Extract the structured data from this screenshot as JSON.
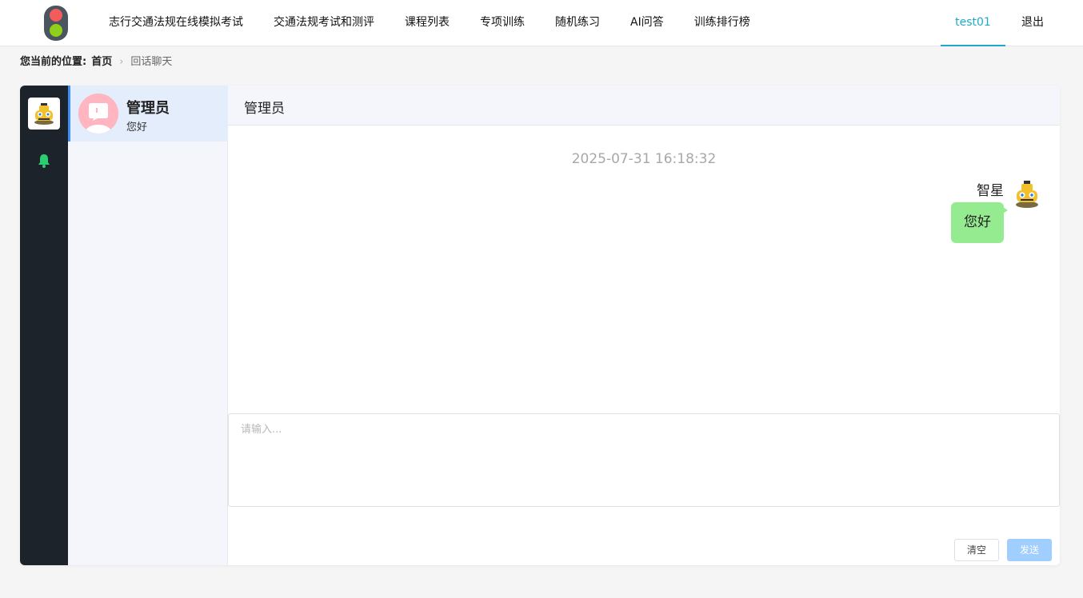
{
  "nav": {
    "items": [
      {
        "label": "志行交通法规在线模拟考试"
      },
      {
        "label": "交通法规考试和测评"
      },
      {
        "label": "课程列表"
      },
      {
        "label": "专项训练"
      },
      {
        "label": "随机练习"
      },
      {
        "label": "AI问答"
      },
      {
        "label": "训练排行榜"
      }
    ],
    "user": "test01",
    "logout": "退出"
  },
  "breadcrumb": {
    "label": "您当前的位置:",
    "home": "首页",
    "separator": "›",
    "current": "回话聊天"
  },
  "contacts": [
    {
      "name": "管理员",
      "last_message": "您好",
      "active": true
    }
  ],
  "chat": {
    "title": "管理员",
    "messages": [
      {
        "time": "2025-07-31 16:18:32",
        "sender": "智星",
        "text": "您好",
        "own": true
      }
    ],
    "input_placeholder": "请输入...",
    "clear_label": "清空",
    "send_label": "发送"
  },
  "colors": {
    "accent": "#21a9c9",
    "rail": "#1c232b",
    "bubble": "#95ec90",
    "send_button": "#a0cfff",
    "bell": "#2ecc71"
  },
  "icons": {
    "logo": "traffic-light-icon",
    "rail_avatar": "taxi-avatar-icon",
    "bell": "bell-icon"
  }
}
